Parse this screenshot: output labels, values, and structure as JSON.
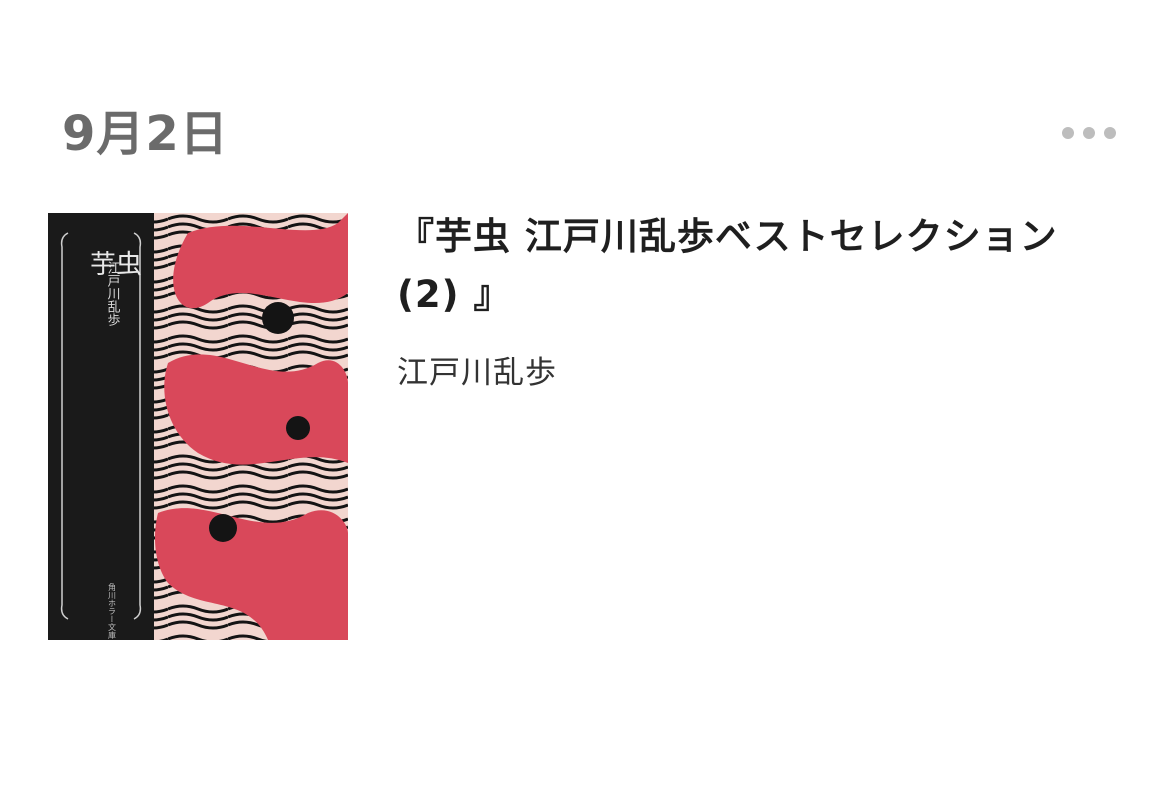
{
  "entry": {
    "date": "9月2日",
    "more_icon": "more-horizontal-icon"
  },
  "book": {
    "title": "『芋虫 江戸川乱歩ベストセレクション (2) 』",
    "author": "江戸川乱歩",
    "cover": {
      "spine_title": "芋虫",
      "spine_author": "江戸川乱歩",
      "spine_publisher": "角川ホラー文庫",
      "colors": {
        "dark": "#1a1a1a",
        "red": "#d9485a",
        "cream": "#f2d6cf",
        "black_line": "#141414"
      }
    }
  }
}
